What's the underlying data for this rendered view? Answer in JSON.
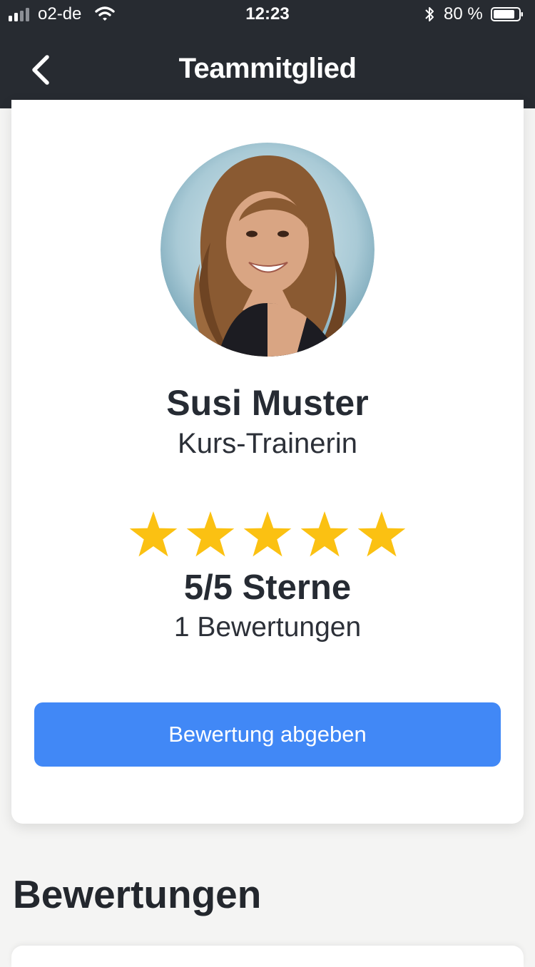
{
  "status_bar": {
    "carrier": "o2-de",
    "time": "12:23",
    "battery": "80 %"
  },
  "nav": {
    "title": "Teammitglied",
    "back_icon": "chevron-left-icon"
  },
  "profile": {
    "name": "Susi Muster",
    "role": "Kurs-Trainerin",
    "rating": 5,
    "rating_max": 5,
    "rating_label": "5/5 Sterne",
    "reviews_label": "1 Bewertungen",
    "rate_button": "Bewertung abgeben"
  },
  "reviews": {
    "heading": "Bewertungen"
  },
  "colors": {
    "header": "#272b31",
    "accent": "#4188f6",
    "star": "#fbc112"
  }
}
